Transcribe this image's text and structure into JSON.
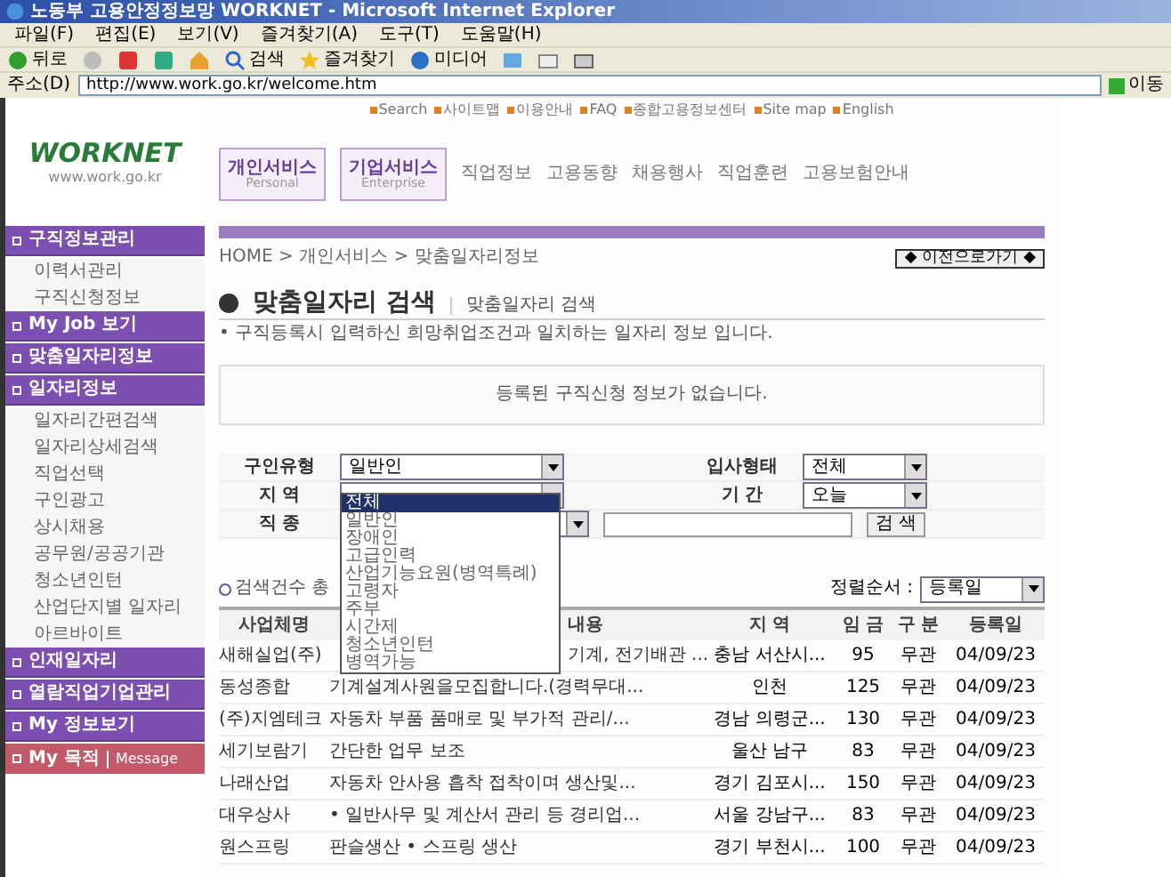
{
  "window": {
    "title": "노동부 고용안정정보망 WORKNET - Microsoft Internet Explorer"
  },
  "menu": [
    "파일(F)",
    "편집(E)",
    "보기(V)",
    "즐겨찾기(A)",
    "도구(T)",
    "도움말(H)"
  ],
  "toolbar": [
    {
      "kind": "back",
      "label": "뒤로"
    },
    {
      "kind": "forward"
    },
    {
      "kind": "stop"
    },
    {
      "kind": "refresh"
    },
    {
      "kind": "home"
    },
    {
      "kind": "search",
      "label": "검색"
    },
    {
      "kind": "favorites",
      "label": "즐겨찾기"
    },
    {
      "kind": "media",
      "label": "미디어"
    },
    {
      "kind": "history"
    },
    {
      "kind": "mail"
    },
    {
      "kind": "print"
    }
  ],
  "address": {
    "label": "주소(D)",
    "value": "http://www.work.go.kr/welcome.htm",
    "go": "이동"
  },
  "top_links": [
    "Search",
    "사이트맵",
    "이용안내",
    "FAQ",
    "종합고용정보센터",
    "Site map",
    "English"
  ],
  "logo": {
    "name": "WORKNET",
    "url": "www.work.go.kr"
  },
  "nav_tabs": [
    {
      "label": "개인서비스",
      "sub": "Personal",
      "kind": "box"
    },
    {
      "label": "기업서비스",
      "sub": "Enterprise",
      "kind": "box"
    },
    {
      "label": "직업정보",
      "kind": "text"
    },
    {
      "label": "고용동향",
      "kind": "text"
    },
    {
      "label": "채용행사",
      "kind": "text"
    },
    {
      "label": "직업훈련",
      "kind": "text"
    },
    {
      "label": "고용보험안내",
      "kind": "text"
    }
  ],
  "sidebar": [
    {
      "label": "구직정보관리",
      "kind": "section"
    },
    {
      "label": "이력서관리",
      "kind": "sub"
    },
    {
      "label": "구직신청정보",
      "kind": "sub"
    },
    {
      "label": "My Job 보기",
      "kind": "section"
    },
    {
      "label": "맞춤일자리정보",
      "kind": "section"
    },
    {
      "label": "일자리정보",
      "kind": "section"
    },
    {
      "label": "일자리간편검색",
      "kind": "sub"
    },
    {
      "label": "일자리상세검색",
      "kind": "sub"
    },
    {
      "label": "직업선택",
      "kind": "sub"
    },
    {
      "label": "구인광고",
      "kind": "sub"
    },
    {
      "label": "상시채용",
      "kind": "sub"
    },
    {
      "label": "공무원/공공기관",
      "kind": "sub"
    },
    {
      "label": "청소년인턴",
      "kind": "sub"
    },
    {
      "label": "산업단지별 일자리",
      "kind": "sub"
    },
    {
      "label": "아르바이트",
      "kind": "sub"
    },
    {
      "label": "인재일자리",
      "kind": "section"
    },
    {
      "label": "열람직업기업관리",
      "kind": "section"
    },
    {
      "label": "My 정보보기",
      "kind": "section"
    },
    {
      "label": "My 목적",
      "extra": "Message",
      "kind": "special"
    }
  ],
  "breadcrumb": "HOME > 개인서비스 > 맞춤일자리정보",
  "back_button": "◆ 이전으로가기 ◆",
  "page_title": "맞춤일자리 검색",
  "page_subtitle": "맞춤일자리 검색",
  "description": "• 구직등록시 입력하신 희망취업조건과 일치하는 일자리 정보 입니다.",
  "notice": "등록된 구직신청 정보가 없습니다.",
  "form": {
    "rows": [
      [
        {
          "label": "구인유형",
          "kind": "select",
          "value": "일반인"
        },
        {
          "label": "입사형태",
          "kind": "select",
          "value": "전체"
        }
      ],
      [
        {
          "label": "지 역",
          "kind": "select"
        },
        {
          "label": "기 간",
          "kind": "select",
          "value": "오늘"
        }
      ],
      [
        {
          "label": "직 종",
          "kind": "keyword"
        }
      ]
    ],
    "search_button": "검 색",
    "dropdown": [
      {
        "label": "전체",
        "selected": true
      },
      {
        "label": "일반인",
        "selected": false
      },
      {
        "label": "장애인",
        "selected": false
      },
      {
        "label": "고급인력",
        "selected": false
      },
      {
        "label": "산업기능요원(병역특례)",
        "selected": false
      },
      {
        "label": "고령자",
        "selected": false
      },
      {
        "label": "주부",
        "selected": false
      },
      {
        "label": "시간제",
        "selected": false
      },
      {
        "label": "청소년인턴",
        "selected": false
      },
      {
        "label": "병역가능",
        "selected": false
      }
    ]
  },
  "result_count": "검색건수 총",
  "sort": {
    "label": "정렬순서 :",
    "value": "등록일"
  },
  "table": {
    "columns": [
      "사업체명",
      "내용",
      "지 역",
      "임 금",
      "구 분",
      "등록일"
    ],
    "rows": [
      [
        "새해실업(주)",
        "기계, 전기배관 ...",
        "충남 서산시...",
        "95",
        "무관",
        "04/09/23"
      ],
      [
        "동성종합",
        "기계설계사원을모집합니다.(경력무대...",
        "인천",
        "125",
        "무관",
        "04/09/23"
      ],
      [
        "(주)지엠테크",
        "자동차 부품 품매로 및 부가적 관리/...",
        "경남 의령군...",
        "130",
        "무관",
        "04/09/23"
      ],
      [
        "세기보람기",
        "간단한 업무 보조",
        "울산 남구",
        "83",
        "무관",
        "04/09/23"
      ],
      [
        "나래산업",
        "자동차 안사용 흡착 접착이며 생산및...",
        "경기 김포시...",
        "150",
        "무관",
        "04/09/23"
      ],
      [
        "대우상사",
        "• 일반사무 및 계산서 관리 등 경리업...",
        "서울 강남구...",
        "83",
        "무관",
        "04/09/23"
      ],
      [
        "원스프링",
        "판슬생산 • 스프링 생산",
        "경기 부천시...",
        "100",
        "무관",
        "04/09/23"
      ]
    ]
  }
}
